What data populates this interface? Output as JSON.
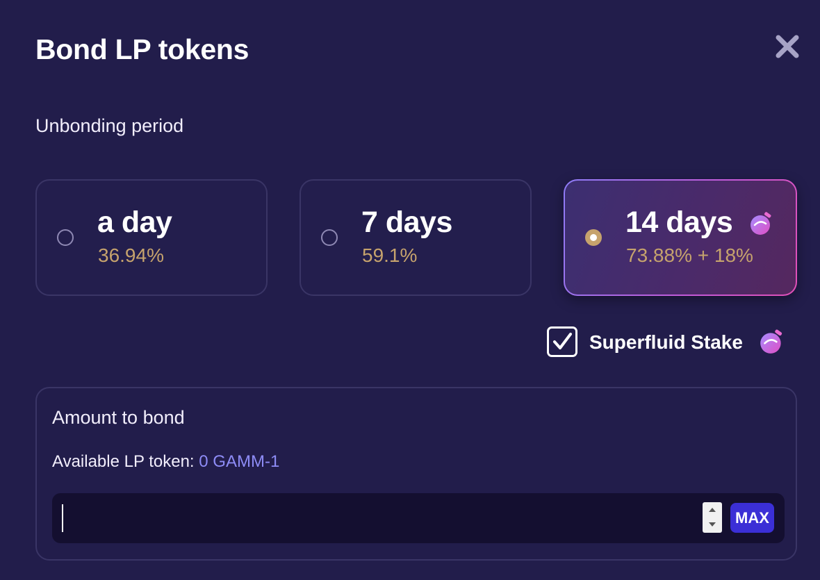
{
  "modal": {
    "title": "Bond LP tokens",
    "close_icon": "close-icon"
  },
  "unbonding": {
    "label": "Unbonding period",
    "options": [
      {
        "label": "a day",
        "apr": "36.94%",
        "selected": false
      },
      {
        "label": "7 days",
        "apr": "59.1%",
        "selected": false
      },
      {
        "label": "14 days",
        "apr": "73.88% + 18%",
        "selected": true,
        "icon": "superfluid-flask-icon"
      }
    ]
  },
  "superfluid": {
    "label": "Superfluid Stake",
    "checked": true,
    "icon": "superfluid-flask-icon"
  },
  "amount": {
    "title": "Amount to bond",
    "available_label": "Available LP token:",
    "available_value": "0 GAMM-1",
    "input_value": "",
    "max_label": "MAX"
  },
  "colors": {
    "background": "#221d4b",
    "apr_gold": "#c6a36d",
    "accent_purple": "#8e8cf6",
    "max_button": "#3b2fd6",
    "selected_border_start": "#8e7cf7",
    "selected_border_end": "#e24fb7"
  }
}
